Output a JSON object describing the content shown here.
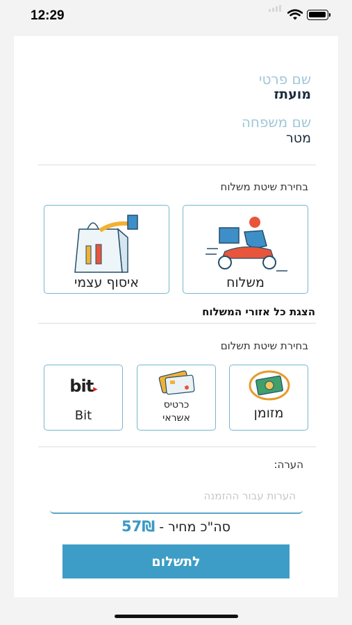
{
  "status_bar": {
    "time": "12:29"
  },
  "profile": {
    "first_name_label": "שם פרטי",
    "first_name": "מועתז",
    "last_name_label": "שם משפחה",
    "last_name": "מטר"
  },
  "shipping": {
    "title": "בחירת שיטת משלוח",
    "options": [
      {
        "label": "משלוח",
        "icon": "delivery-scooter-icon"
      },
      {
        "label": "איסוף עצמי",
        "icon": "pickup-bag-icon"
      }
    ],
    "show_all_areas": "הצגת כל אזורי המשלוח"
  },
  "payment": {
    "title": "בחירת שיטת תשלום",
    "options": [
      {
        "label": "מזומן",
        "icon": "cash-icon"
      },
      {
        "label": "כרטיס אשראי",
        "line1": "כרטיס",
        "line2": "אשראי",
        "icon": "credit-card-icon"
      },
      {
        "label": "Bit",
        "icon": "bit-logo-icon",
        "logo_text": "bit"
      }
    ]
  },
  "note": {
    "label": "הערה:",
    "placeholder": "הערות עבור ההזמנה",
    "value": ""
  },
  "total": {
    "label": "סה\"כ מחיר -",
    "price": "57₪"
  },
  "pay_button": "לתשלום",
  "colors": {
    "accent": "#3d9dc6",
    "option_border": "#78b5cf",
    "label_light": "#9fc7d8",
    "delivery_orange": "#e8553b",
    "delivery_blue": "#3e8fc7",
    "cash_green": "#3fa06a",
    "bit_red": "#e2231a"
  }
}
